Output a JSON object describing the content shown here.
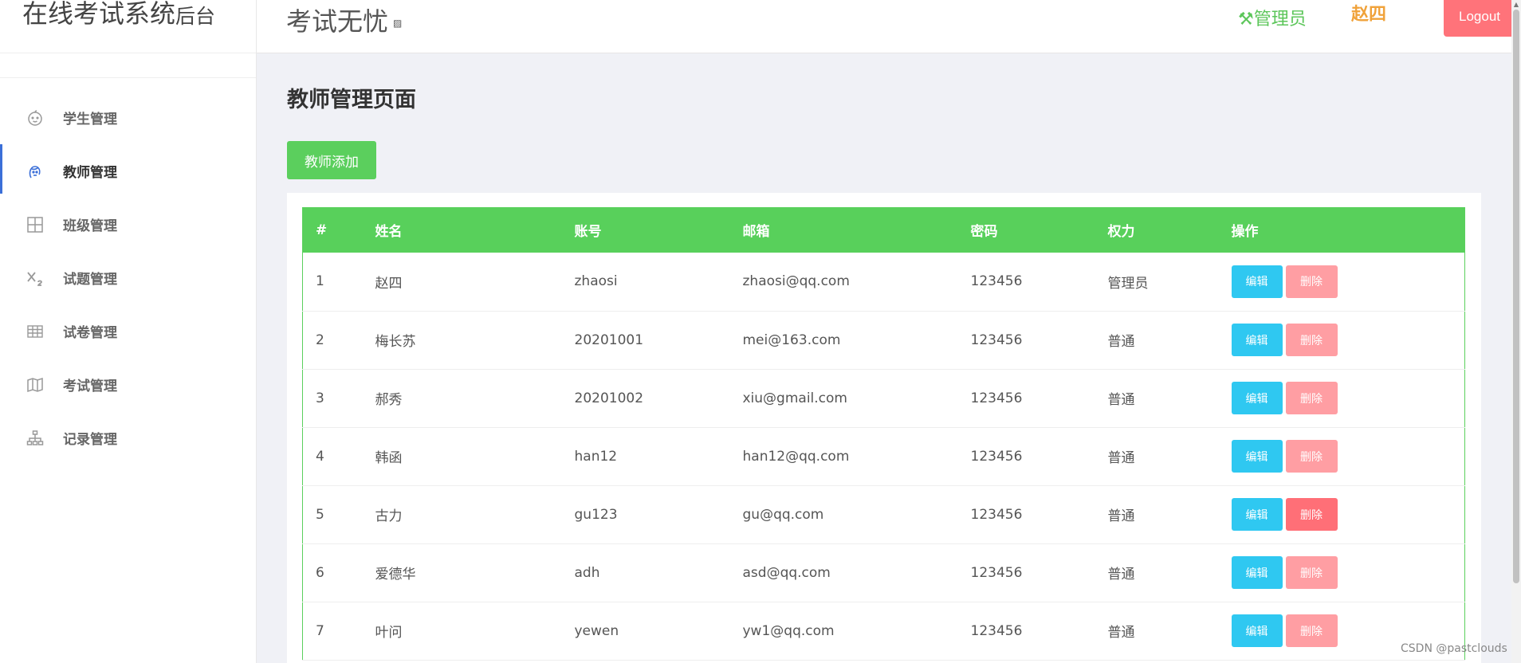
{
  "sidebar": {
    "brand_main": "在线考试系统",
    "brand_sub": "后台",
    "items": [
      {
        "label": "学生管理",
        "icon": "baby-face-icon",
        "active": false
      },
      {
        "label": "教师管理",
        "icon": "person-head-icon",
        "active": true
      },
      {
        "label": "班级管理",
        "icon": "grid-icon",
        "active": false
      },
      {
        "label": "试题管理",
        "icon": "subscript-icon",
        "active": false
      },
      {
        "label": "试卷管理",
        "icon": "table-icon",
        "active": false
      },
      {
        "label": "考试管理",
        "icon": "map-icon",
        "active": false
      },
      {
        "label": "记录管理",
        "icon": "hierarchy-icon",
        "active": false
      }
    ]
  },
  "header": {
    "title": "考试无忧",
    "role": "管理员",
    "username": "赵四",
    "logout": "Logout"
  },
  "main": {
    "page_title": "教师管理页面",
    "add_button": "教师添加",
    "table": {
      "columns": [
        "#",
        "姓名",
        "账号",
        "邮箱",
        "密码",
        "权力",
        "操作"
      ],
      "edit_label": "编辑",
      "delete_label": "删除",
      "rows": [
        {
          "id": "1",
          "name": "赵四",
          "account": "zhaosi",
          "email": "zhaosi@qq.com",
          "password": "123456",
          "power": "管理员"
        },
        {
          "id": "2",
          "name": "梅长苏",
          "account": "20201001",
          "email": "mei@163.com",
          "password": "123456",
          "power": "普通"
        },
        {
          "id": "3",
          "name": "郝秀",
          "account": "20201002",
          "email": "xiu@gmail.com",
          "password": "123456",
          "power": "普通"
        },
        {
          "id": "4",
          "name": "韩函",
          "account": "han12",
          "email": "han12@qq.com",
          "password": "123456",
          "power": "普通"
        },
        {
          "id": "5",
          "name": "古力",
          "account": "gu123",
          "email": "gu@qq.com",
          "password": "123456",
          "power": "普通"
        },
        {
          "id": "6",
          "name": "爱德华",
          "account": "adh",
          "email": "asd@qq.com",
          "password": "123456",
          "power": "普通"
        },
        {
          "id": "7",
          "name": "叶问",
          "account": "yewen",
          "email": "yw1@qq.com",
          "password": "123456",
          "power": "普通"
        }
      ]
    }
  },
  "watermark": "CSDN @pastclouds",
  "colors": {
    "green": "#5bcf5d",
    "blue_edit": "#2fc8f1",
    "pink_delete": "#ff9ea3",
    "logout": "#ff737a",
    "username": "#f0a23a"
  }
}
